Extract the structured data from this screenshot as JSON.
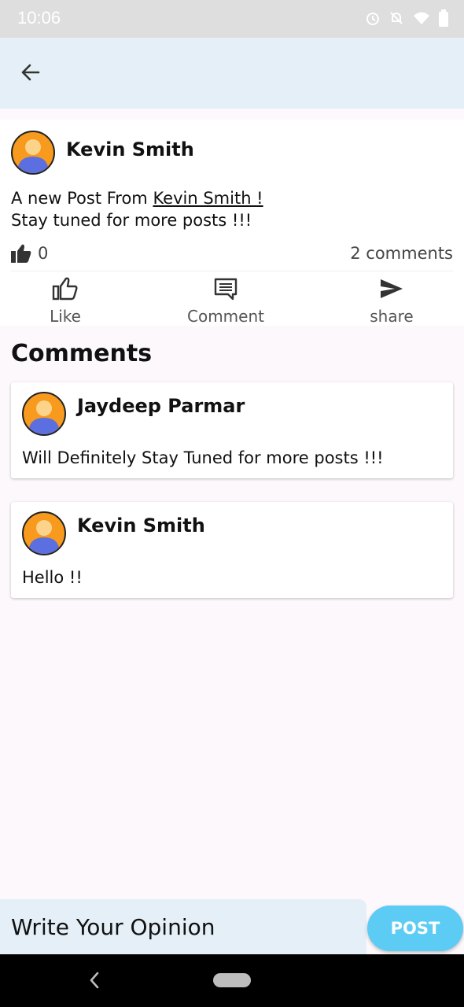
{
  "status_bar": {
    "time": "10:06",
    "icons": [
      "alarm-icon",
      "notifications-off-icon",
      "wifi-icon",
      "battery-icon"
    ]
  },
  "app_bar": {
    "back_icon": "arrow-left-icon"
  },
  "post": {
    "author": "Kevin Smith",
    "body_prefix": "A new Post From ",
    "mention": "Kevin Smith ! ",
    "body_line2": "Stay tuned for more posts !!!",
    "like_count": "0",
    "comment_count": "2 comments",
    "actions": {
      "like": "Like",
      "comment": "Comment",
      "share": "share"
    }
  },
  "comments_section": {
    "title": "Comments",
    "items": [
      {
        "author": "Jaydeep Parmar",
        "text": "Will Definitely Stay Tuned for more posts !!!"
      },
      {
        "author": "Kevin Smith",
        "text": "Hello !!"
      }
    ]
  },
  "composer": {
    "placeholder": "Write Your Opinion",
    "post_label": "POST"
  },
  "colors": {
    "app_bar_bg": "#E4EFF7",
    "post_button": "#5CCCF5",
    "avatar_bg": "#F79A1E",
    "avatar_person": "#5B6FE0"
  }
}
